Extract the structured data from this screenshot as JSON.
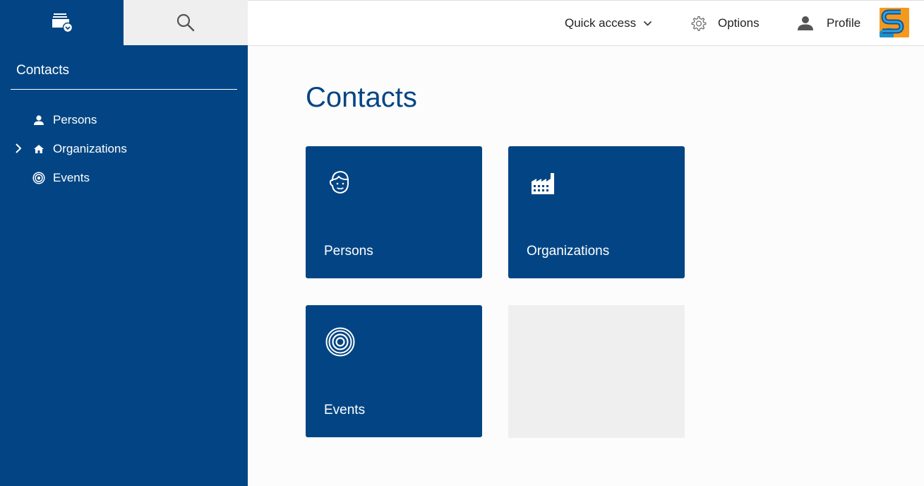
{
  "sidebar": {
    "title": "Contacts",
    "items": [
      {
        "label": "Persons",
        "icon": "person-icon"
      },
      {
        "label": "Organizations",
        "icon": "home-icon",
        "expandable": true
      },
      {
        "label": "Events",
        "icon": "target-icon"
      }
    ]
  },
  "topbar": {
    "quick_access": "Quick access",
    "options": "Options",
    "profile": "Profile"
  },
  "main": {
    "title": "Contacts",
    "tiles": [
      {
        "label": "Persons",
        "icon": "face-icon"
      },
      {
        "label": "Organizations",
        "icon": "factory-icon"
      },
      {
        "label": "Events",
        "icon": "target-icon"
      }
    ]
  },
  "colors": {
    "brand": "#034584",
    "search_bg": "#efefef",
    "logo": "#f39a1e"
  }
}
